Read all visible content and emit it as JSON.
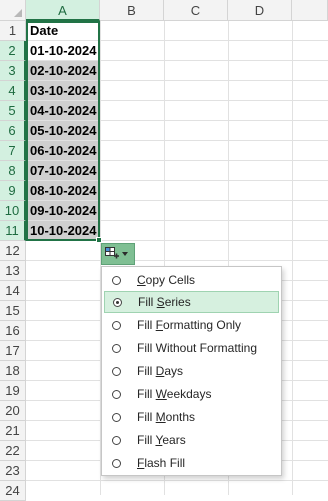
{
  "columns": [
    "A",
    "B",
    "C",
    "D"
  ],
  "rows": [
    "1",
    "2",
    "3",
    "4",
    "5",
    "6",
    "7",
    "8",
    "9",
    "10",
    "11",
    "12",
    "13",
    "14",
    "15",
    "16",
    "17",
    "18",
    "19",
    "20",
    "21",
    "22",
    "23",
    "24"
  ],
  "cells": {
    "header": "Date",
    "dates": [
      "01-10-2024",
      "02-10-2024",
      "03-10-2024",
      "04-10-2024",
      "05-10-2024",
      "06-10-2024",
      "07-10-2024",
      "08-10-2024",
      "09-10-2024",
      "10-10-2024"
    ]
  },
  "autofill": {
    "icon": "autofill-options-icon",
    "accent": "#217346"
  },
  "menu": {
    "items": [
      {
        "pre": "",
        "key": "C",
        "post": "opy Cells"
      },
      {
        "pre": "Fill ",
        "key": "S",
        "post": "eries"
      },
      {
        "pre": "Fill ",
        "key": "F",
        "post": "ormatting Only"
      },
      {
        "pre": "Fill Without Formatting",
        "key": "",
        "post": ""
      },
      {
        "pre": "Fill ",
        "key": "D",
        "post": "ays"
      },
      {
        "pre": "Fill ",
        "key": "W",
        "post": "eekdays"
      },
      {
        "pre": "Fill ",
        "key": "M",
        "post": "onths"
      },
      {
        "pre": "Fill ",
        "key": "Y",
        "post": "ears"
      },
      {
        "pre": "",
        "key": "F",
        "post": "lash Fill"
      }
    ],
    "selected_index": 1
  }
}
